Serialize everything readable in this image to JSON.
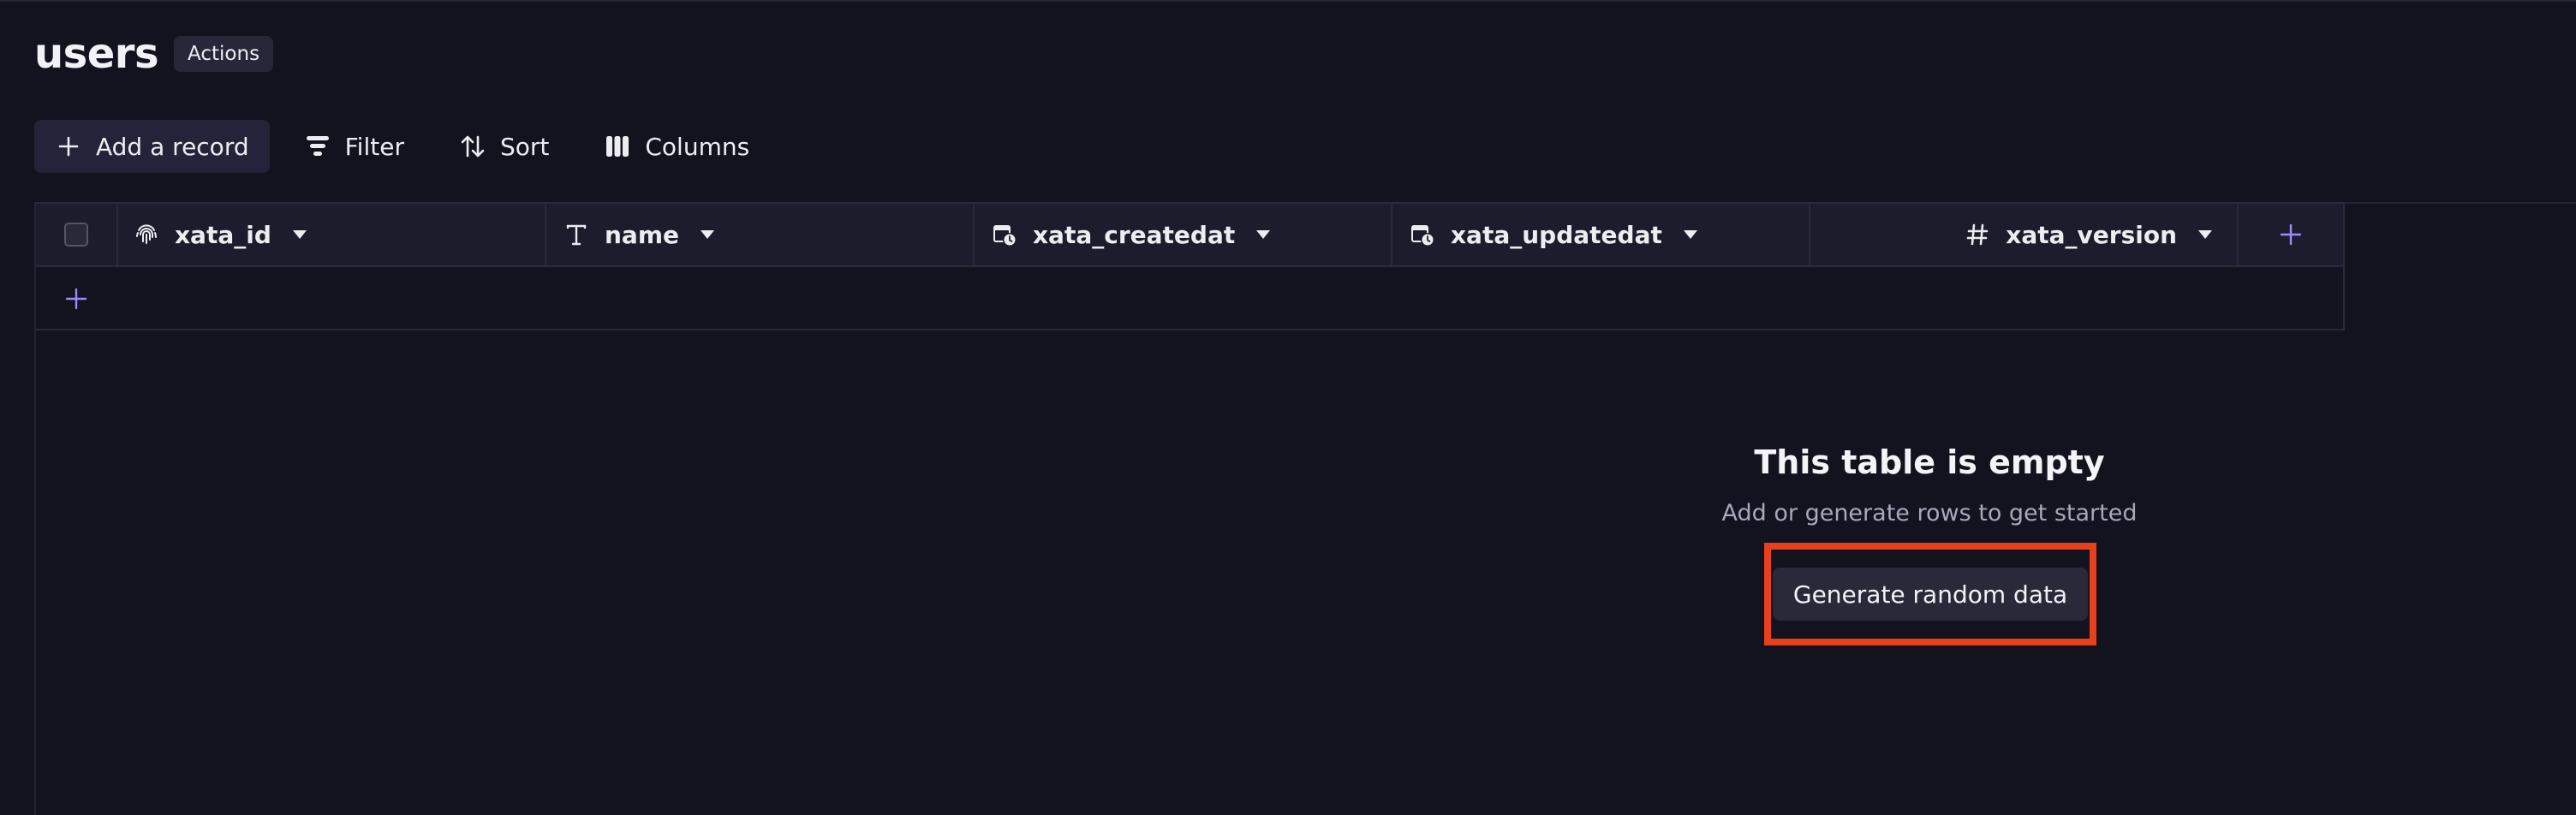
{
  "page": {
    "title": "users",
    "actions_label": "Actions"
  },
  "toolbar": {
    "add_record_label": "Add a record",
    "filter_label": "Filter",
    "sort_label": "Sort",
    "columns_label": "Columns"
  },
  "table": {
    "columns": [
      {
        "label": "xata_id",
        "icon": "fingerprint-icon"
      },
      {
        "label": "name",
        "icon": "text-type-icon"
      },
      {
        "label": "xata_createdat",
        "icon": "calendar-clock-icon"
      },
      {
        "label": "xata_updatedat",
        "icon": "calendar-clock-icon"
      },
      {
        "label": "xata_version",
        "icon": "hash-icon"
      }
    ]
  },
  "empty_state": {
    "title": "This table is empty",
    "subtitle": "Add or generate rows to get started",
    "button_label": "Generate random data"
  },
  "colors": {
    "background": "#13121f",
    "accent": "#9b8cff",
    "highlight": "#e7401c"
  }
}
